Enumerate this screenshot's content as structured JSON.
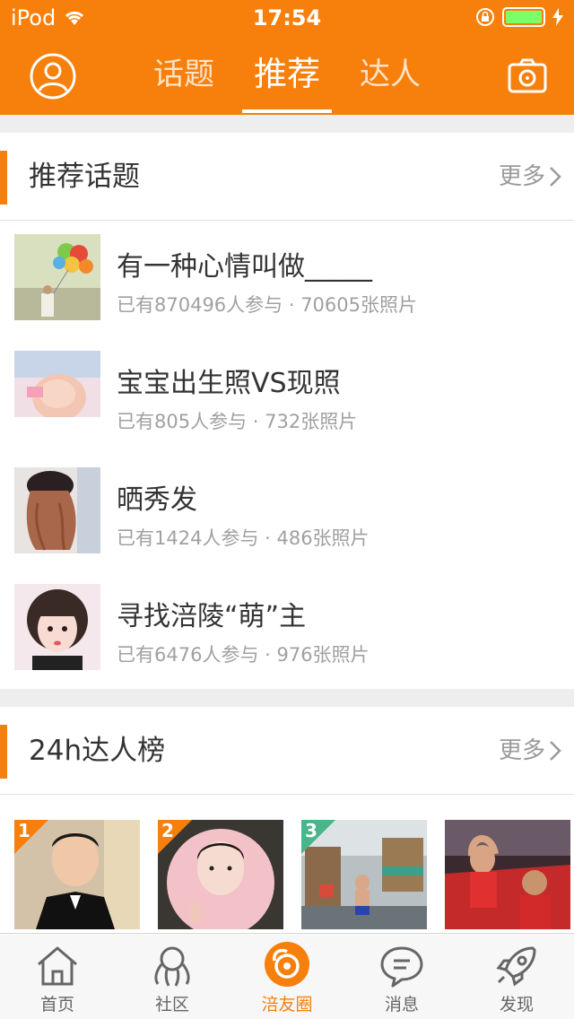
{
  "status": {
    "carrier": "iPod",
    "time": "17:54"
  },
  "header": {
    "tabs": [
      {
        "label": "话题",
        "active": false
      },
      {
        "label": "推荐",
        "active": true
      },
      {
        "label": "达人",
        "active": false
      }
    ],
    "accent_color": "#f77f0b"
  },
  "topics_section": {
    "title": "推荐话题",
    "more": "更多",
    "items": [
      {
        "name": "有一种心情叫做_____",
        "meta": "已有870496人参与 · 70605张照片"
      },
      {
        "name": "宝宝出生照VS现照",
        "meta": "已有805人参与 · 732张照片"
      },
      {
        "name": "晒秀发",
        "meta": "已有1424人参与 · 486张照片"
      },
      {
        "name": "寻找涪陵“萌”主",
        "meta": "已有6476人参与 · 976张照片"
      }
    ]
  },
  "ranking_section": {
    "title": "24h达人榜",
    "more": "更多",
    "people": [
      {
        "rank": "1"
      },
      {
        "rank": "2"
      },
      {
        "rank": "3"
      },
      {
        "rank": ""
      }
    ]
  },
  "tabbar": {
    "items": [
      {
        "label": "首页",
        "icon": "home-icon"
      },
      {
        "label": "社区",
        "icon": "community-icon"
      },
      {
        "label": "涪友圈",
        "icon": "friends-circle-icon",
        "active": true
      },
      {
        "label": "消息",
        "icon": "message-icon"
      },
      {
        "label": "发现",
        "icon": "rocket-icon"
      }
    ]
  }
}
